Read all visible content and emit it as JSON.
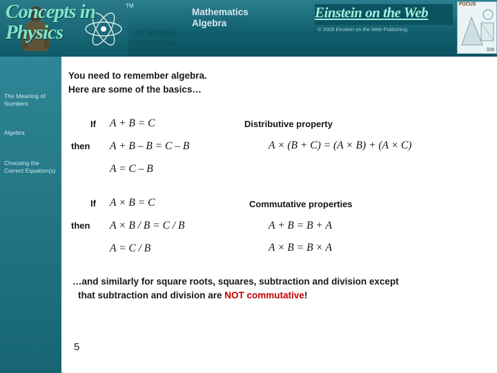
{
  "header": {
    "logo_line1": "Concepts in",
    "logo_line2": "Physics",
    "trademark": "TM",
    "author_line1": "Dr. Michael",
    "author_line2": "De:Antonio",
    "subject_title": "Mathematics",
    "subject_subtitle": "Algebra",
    "banner_text": "Einstein on the Web",
    "banner_copyright": "© 2009 Einstein on the  Web Publishing",
    "photo_title": "FOCUS",
    "photo_caption": "338",
    "accent_color": "#1b6a7a",
    "logo_color": "#7fe6c8"
  },
  "sidebar": {
    "items": [
      {
        "label": "The Meaning of Numbers"
      },
      {
        "label": "Algebra"
      },
      {
        "label": "Choosing the Correct Equation(s)"
      }
    ]
  },
  "main": {
    "intro_line1": "You need to remember algebra.",
    "intro_line2": "Here are some of the basics…",
    "block1": {
      "if_label": "If",
      "then_label": "then",
      "eq_if": "A + B = C",
      "eq_then1": "A + B – B = C – B",
      "eq_then2": "A = C – B",
      "right_heading": "Distributive property",
      "right_eq": "A × (B + C) = (A × B) + (A × C)"
    },
    "block2": {
      "if_label": "If",
      "then_label": "then",
      "eq_if": "A × B = C",
      "eq_then1": "A × B / B = C / B",
      "eq_then2": "A = C / B",
      "right_heading": "Commutative properties",
      "right_eq1": "A + B = B + A",
      "right_eq2": "A × B = B × A"
    },
    "footer_line1": "…and similarly for square roots, squares, subtraction and division except",
    "footer_line2_a": "that subtraction and division are ",
    "footer_line2_red": "NOT commutative",
    "footer_line2_b": "!",
    "red_color": "#c00000"
  },
  "page_number": "5"
}
